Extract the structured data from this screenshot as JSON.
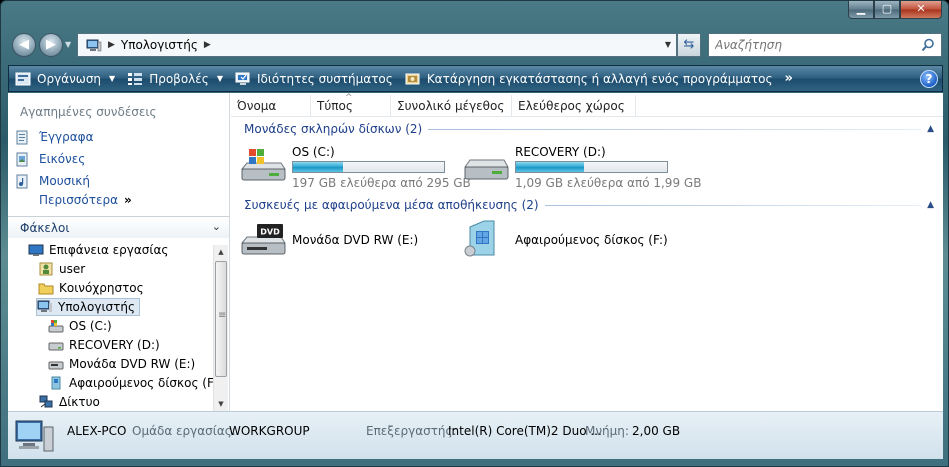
{
  "window": {
    "buttons": {
      "minimize": "▁",
      "maximize": "▢",
      "close": "✕"
    }
  },
  "address": {
    "crumb": "Υπολογιστής"
  },
  "search": {
    "placeholder": "Αναζήτηση"
  },
  "toolbar": {
    "organize": "Οργάνωση",
    "views": "Προβολές",
    "system_properties": "Ιδιότητες συστήματος",
    "uninstall": "Κατάργηση εγκατάστασης ή αλλαγή ενός προγράμματος",
    "more": "»",
    "help": "?"
  },
  "favorites": {
    "title": "Αγαπημένες συνδέσεις",
    "items": [
      {
        "label": "Έγγραφα",
        "icon": "documents-icon"
      },
      {
        "label": "Εικόνες",
        "icon": "pictures-icon"
      },
      {
        "label": "Μουσική",
        "icon": "music-icon"
      }
    ],
    "more": "Περισσότερα",
    "more_chevron": "»"
  },
  "folders": {
    "title": "Φάκελοι",
    "tree": [
      {
        "label": "Επιφάνεια εργασίας",
        "icon": "desktop-icon"
      },
      {
        "label": "user",
        "icon": "user-folder-icon"
      },
      {
        "label": "Κοινόχρηστος",
        "icon": "folder-icon"
      },
      {
        "label": "Υπολογιστής",
        "icon": "computer-icon"
      },
      {
        "label": "OS (C:)",
        "icon": "os-drive-icon"
      },
      {
        "label": "RECOVERY (D:)",
        "icon": "hard-drive-icon"
      },
      {
        "label": "Μονάδα DVD RW (E:)",
        "icon": "dvd-drive-icon"
      },
      {
        "label": "Αφαιρούμενος δίσκος (F:)",
        "icon": "removable-disk-icon"
      },
      {
        "label": "Δίκτυο",
        "icon": "network-icon"
      }
    ]
  },
  "columns": [
    "Όνομα",
    "Τύπος",
    "Συνολικό μέγεθος",
    "Ελεύθερος χώρος"
  ],
  "groups": {
    "hdd": {
      "label": "Μονάδες σκληρών δίσκων (2)"
    },
    "removable": {
      "label": "Συσκευές με αφαιρούμενα μέσα αποθήκευσης (2)"
    }
  },
  "drives": {
    "c": {
      "name": "OS (C:)",
      "free": "197 GB ελεύθερα από 295 GB",
      "used_fraction": 0.33
    },
    "d": {
      "name": "RECOVERY (D:)",
      "free": "1,09 GB ελεύθερα από 1,99 GB",
      "used_fraction": 0.45
    },
    "e": {
      "name": "Μονάδα DVD RW (E:)",
      "badge": "DVD"
    },
    "f": {
      "name": "Αφαιρούμενος δίσκος (F:)"
    }
  },
  "details": {
    "computer_name": "ALEX-PCO",
    "workgroup_label": "Ομάδα εργασίας:",
    "workgroup": "WORKGROUP",
    "processor_label": "Επεξεργαστής:",
    "processor": "Intel(R) Core(TM)2 Duo ...",
    "memory_label": "Μνήμη:",
    "memory": "2,00 GB"
  },
  "colors": {
    "accent": "#1c4f9c",
    "progress": "#28a5d1",
    "toolbar": "#2e5f80"
  }
}
